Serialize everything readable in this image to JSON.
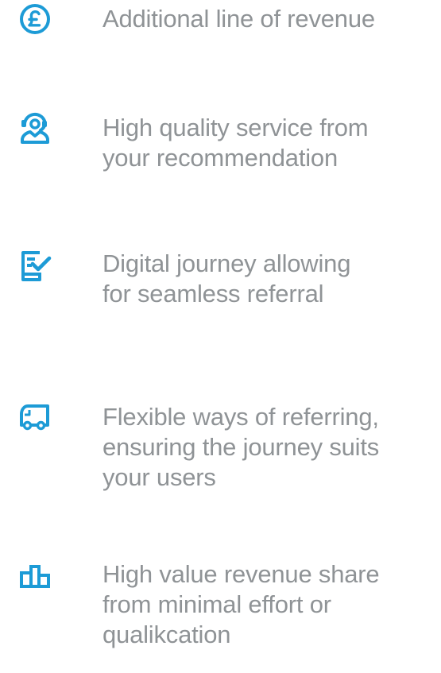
{
  "accent_color": "#1d9bd6",
  "text_color": "#8f9396",
  "features": [
    {
      "icon": "pound-coin-icon",
      "lines": [
        "Additional line of revenue"
      ]
    },
    {
      "icon": "service-person-icon",
      "lines": [
        "High quality service from",
        "your recommendation"
      ]
    },
    {
      "icon": "tablet-check-icon",
      "lines": [
        "Digital journey allowing",
        "for seamless referral"
      ]
    },
    {
      "icon": "delivery-van-icon",
      "lines": [
        "Flexible ways of referring,",
        "ensuring the journey suits",
        "your users"
      ]
    },
    {
      "icon": "bar-chart-icon",
      "lines": [
        "High value revenue share",
        "from minimal effort or",
        "qualikcation"
      ]
    }
  ]
}
